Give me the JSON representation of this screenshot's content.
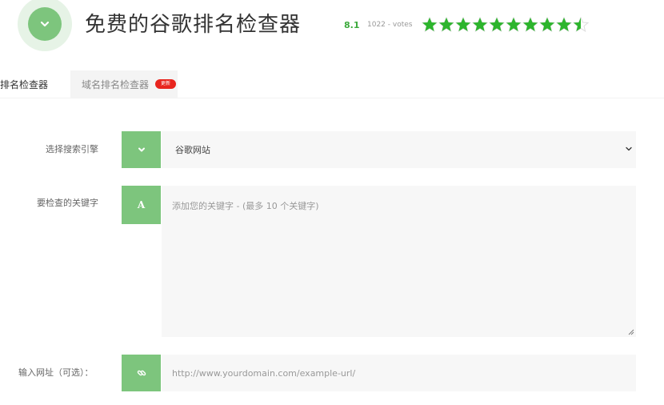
{
  "header": {
    "title": "免费的谷歌排名检查器",
    "rating": "8.1",
    "votes": "1022 - votes",
    "stars_value": 9.5,
    "stars_total": 10,
    "logo_icon": "chevron-down-icon"
  },
  "tabs": [
    {
      "label": "排名检查器",
      "active": true
    },
    {
      "label": "域名排名检查器",
      "active": false,
      "badge": "更新"
    }
  ],
  "form": {
    "engine": {
      "label": "选择搜索引擎",
      "value": "谷歌网站",
      "icon": "chevron-down-icon"
    },
    "keywords": {
      "label": "要检查的关键字",
      "placeholder": "添加您的关键字 - (最多 10 个关键字)",
      "icon_letter": "A"
    },
    "url": {
      "label": "输入网址（可选）：",
      "placeholder": "http://www.yourdomain.com/example-url/",
      "icon": "link-icon"
    }
  },
  "colors": {
    "accent": "#7dc57d",
    "star": "#2db52d",
    "badge": "#e8251e",
    "rating_text": "#3caa3c"
  }
}
